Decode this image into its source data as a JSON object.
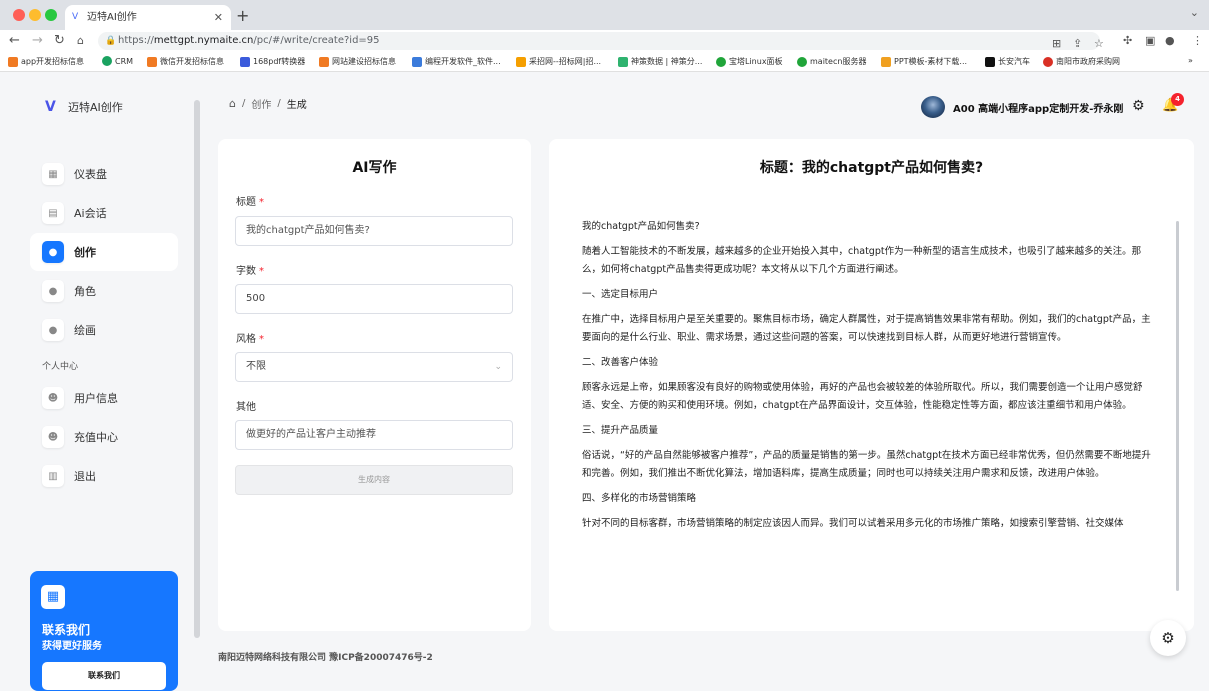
{
  "browser": {
    "tab_title": "迈特AI创作",
    "tab_favicon": "V",
    "url_scheme": "https://",
    "url_host": "mettgpt.nymaite.cn",
    "url_path": "/pc/#/write/create?id=95",
    "bookmarks": [
      {
        "label": "app开发招标信息",
        "color": "#f07a23"
      },
      {
        "label": "CRM",
        "color": "#1aa260"
      },
      {
        "label": "微信开发招标信息",
        "color": "#f07a23"
      },
      {
        "label": "168pdf转换器",
        "color": "#3b5bdb"
      },
      {
        "label": "网站建设招标信息",
        "color": "#f07a23"
      },
      {
        "label": "编程开发软件_软件...",
        "color": "#3b7bdb"
      },
      {
        "label": "采招网--招标网|招...",
        "color": "#f59f00"
      },
      {
        "label": "神策数据 | 神策分...",
        "color": "#2fb36f"
      },
      {
        "label": "宝塔Linux面板",
        "color": "#20a53a"
      },
      {
        "label": "maitecn服务器",
        "color": "#20a53a"
      },
      {
        "label": "PPT模板-素材下载...",
        "color": "#f0a020"
      },
      {
        "label": "长安汽车",
        "color": "#111111"
      },
      {
        "label": "南阳市政府采购网",
        "color": "#d93025"
      }
    ]
  },
  "app": {
    "logo_text": "迈特AI创作",
    "nav": [
      {
        "label": "仪表盘",
        "icon": "dashboard-icon"
      },
      {
        "label": "Ai会话",
        "icon": "chat-icon"
      },
      {
        "label": "创作",
        "icon": "drop-icon"
      },
      {
        "label": "角色",
        "icon": "drop-icon"
      },
      {
        "label": "绘画",
        "icon": "drop-icon"
      }
    ],
    "section_label": "个人中心",
    "nav2": [
      {
        "label": "用户信息",
        "icon": "user-icon"
      },
      {
        "label": "充值中心",
        "icon": "user-icon"
      },
      {
        "label": "退出",
        "icon": "trash-icon"
      }
    ],
    "promo": {
      "title": "联系我们",
      "subtitle": "获得更好服务",
      "button": "联系我们"
    }
  },
  "header": {
    "breadcrumb": [
      "创作",
      "生成"
    ],
    "user_name": "A00 高端小程序app定制开发-乔永刚",
    "notification_count": "4"
  },
  "form": {
    "title": "AI写作",
    "title_label": "标题",
    "title_placeholder": "我的chatgpt产品如何售卖?",
    "words_label": "字数",
    "words_value": "500",
    "style_label": "风格",
    "style_value": "不限",
    "other_label": "其他",
    "other_placeholder": "做更好的产品让客户主动推荐",
    "generate_button": "生成内容"
  },
  "article": {
    "heading": "标题：我的chatgpt产品如何售卖?",
    "paragraphs": [
      "我的chatgpt产品如何售卖?",
      "随着人工智能技术的不断发展，越来越多的企业开始投入其中，chatgpt作为一种新型的语言生成技术，也吸引了越来越多的关注。那么，如何将chatgpt产品售卖得更成功呢？本文将从以下几个方面进行阐述。",
      "一、选定目标用户",
      "在推广中，选择目标用户是至关重要的。聚焦目标市场，确定人群属性，对于提高销售效果非常有帮助。例如，我们的chatgpt产品，主要面向的是什么行业、职业、需求场景，通过这些问题的答案，可以快速找到目标人群，从而更好地进行营销宣传。",
      "二、改善客户体验",
      "顾客永远是上帝，如果顾客没有良好的购物或使用体验，再好的产品也会被较差的体验所取代。所以，我们需要创造一个让用户感觉舒适、安全、方便的购买和使用环境。例如，chatgpt在产品界面设计，交互体验，性能稳定性等方面，都应该注重细节和用户体验。",
      "三、提升产品质量",
      "俗话说，“好的产品自然能够被客户推荐”，产品的质量是销售的第一步。虽然chatgpt在技术方面已经非常优秀，但仍然需要不断地提升和完善。例如，我们推出不断优化算法，增加语料库，提高生成质量；同时也可以持续关注用户需求和反馈，改进用户体验。",
      "四、多样化的市场营销策略",
      "针对不同的目标客群，市场营销策略的制定应该因人而异。我们可以试着采用多元化的市场推广策略，如搜索引擎营销、社交媒体"
    ]
  },
  "footer": {
    "text": "南阳迈特网络科技有限公司   豫ICP备20007476号-2"
  }
}
